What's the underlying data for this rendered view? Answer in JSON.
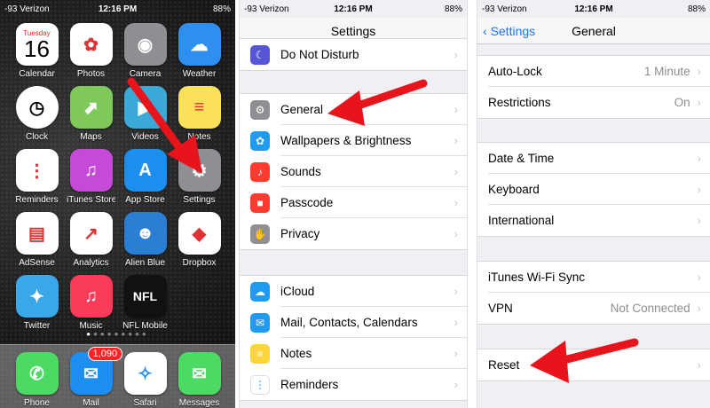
{
  "home": {
    "status": {
      "carrier": "-93 Verizon",
      "time": "12:16 PM",
      "battery": "88%"
    },
    "calendar": {
      "day": "Tuesday",
      "date": "16"
    },
    "apps": [
      {
        "label": "Calendar",
        "icon": "calendar-icon",
        "color": "#ffffff"
      },
      {
        "label": "Photos",
        "icon": "photos-icon",
        "color": "#ffffff"
      },
      {
        "label": "Camera",
        "icon": "camera-icon",
        "color": "#8e8e93"
      },
      {
        "label": "Weather",
        "icon": "weather-icon",
        "color": "#2f8ff0"
      },
      {
        "label": "Clock",
        "icon": "clock-icon",
        "color": "#000000"
      },
      {
        "label": "Maps",
        "icon": "maps-icon",
        "color": "#7fc95a"
      },
      {
        "label": "Videos",
        "icon": "videos-icon",
        "color": "#3ba9d8"
      },
      {
        "label": "Notes",
        "icon": "notes-icon",
        "color": "#fbe05c"
      },
      {
        "label": "Reminders",
        "icon": "reminders-icon",
        "color": "#ffffff"
      },
      {
        "label": "iTunes Store",
        "icon": "itunes-icon",
        "color": "#c64ad8"
      },
      {
        "label": "App Store",
        "icon": "appstore-icon",
        "color": "#1b8ff0"
      },
      {
        "label": "Settings",
        "icon": "settings-gear-icon",
        "color": "#8e8e93"
      },
      {
        "label": "AdSense",
        "icon": "adsense-icon",
        "color": "#ffffff"
      },
      {
        "label": "Analytics",
        "icon": "analytics-icon",
        "color": "#ffffff"
      },
      {
        "label": "Alien Blue",
        "icon": "alien-blue-icon",
        "color": "#2a7fd4"
      },
      {
        "label": "Dropbox",
        "icon": "dropbox-icon",
        "color": "#ffffff"
      },
      {
        "label": "Twitter",
        "icon": "twitter-icon",
        "color": "#3aa7e8"
      },
      {
        "label": "Music",
        "icon": "music-icon",
        "color": "#fb3b5a"
      },
      {
        "label": "NFL Mobile",
        "icon": "nfl-icon",
        "color": "#111111"
      }
    ],
    "dock": [
      {
        "label": "Phone",
        "icon": "phone-icon",
        "color": "#4cd964"
      },
      {
        "label": "Mail",
        "icon": "mail-icon",
        "color": "#1e8ff0",
        "badge": "1,090"
      },
      {
        "label": "Safari",
        "icon": "safari-icon",
        "color": "#ffffff"
      },
      {
        "label": "Messages",
        "icon": "messages-icon",
        "color": "#4cd964"
      }
    ]
  },
  "settings": {
    "status": {
      "carrier": "-93 Verizon",
      "time": "12:16 PM",
      "battery": "88%"
    },
    "title": "Settings",
    "group1": [
      {
        "label": "Do Not Disturb",
        "color": "#5856d6",
        "glyph": "☾"
      }
    ],
    "group2": [
      {
        "label": "General",
        "color": "#8e8e93",
        "glyph": "⚙"
      },
      {
        "label": "Wallpapers & Brightness",
        "color": "#1f9bf0",
        "glyph": "✿"
      },
      {
        "label": "Sounds",
        "color": "#ff3b30",
        "glyph": "♪"
      },
      {
        "label": "Passcode",
        "color": "#ff3b30",
        "glyph": "■"
      },
      {
        "label": "Privacy",
        "color": "#8e8e93",
        "glyph": "✋"
      }
    ],
    "group3": [
      {
        "label": "iCloud",
        "color": "#1f9bf0",
        "glyph": "☁"
      },
      {
        "label": "Mail, Contacts, Calendars",
        "color": "#1f9bf0",
        "glyph": "✉"
      },
      {
        "label": "Notes",
        "color": "#fbd539",
        "glyph": "≡"
      },
      {
        "label": "Reminders",
        "color": "#ffffff",
        "glyph": "⋮"
      }
    ]
  },
  "general": {
    "status": {
      "carrier": "-93 Verizon",
      "time": "12:16 PM",
      "battery": "88%"
    },
    "back": "Settings",
    "title": "General",
    "group1": [
      {
        "label": "Auto-Lock",
        "value": "1 Minute"
      },
      {
        "label": "Restrictions",
        "value": "On"
      }
    ],
    "group2": [
      {
        "label": "Date & Time",
        "value": ""
      },
      {
        "label": "Keyboard",
        "value": ""
      },
      {
        "label": "International",
        "value": ""
      }
    ],
    "group3": [
      {
        "label": "iTunes Wi-Fi Sync",
        "value": ""
      },
      {
        "label": "VPN",
        "value": "Not Connected"
      }
    ],
    "group4": [
      {
        "label": "Reset",
        "value": ""
      }
    ]
  },
  "annotation_color": "#e8141b"
}
